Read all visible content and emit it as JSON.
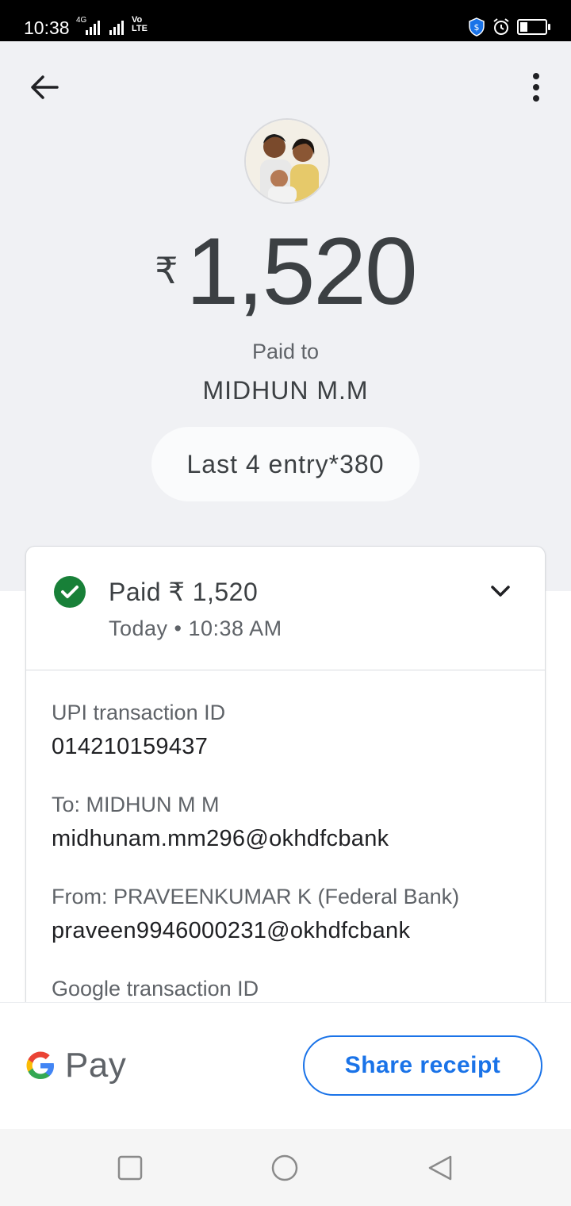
{
  "status_bar": {
    "time": "10:38",
    "network": "4G",
    "volte_top": "Vo",
    "volte_bottom": "LTE",
    "battery_level_percent": 30,
    "icons": [
      "signal-icon",
      "signal-icon",
      "shield-icon",
      "alarm-icon",
      "battery-icon"
    ]
  },
  "header": {
    "back_icon": "arrow-back-icon",
    "menu_icon": "more-vert-icon",
    "avatar": "contact-avatar-photo",
    "currency": "₹",
    "amount": "1,520",
    "paid_to_label": "Paid to",
    "payee_name": "MIDHUN M.M",
    "account_pill": "Last 4 entry*380"
  },
  "transaction_card": {
    "status_title": "Paid ₹ 1,520",
    "status_time": "Today • 10:38 AM",
    "status_icon": "check-circle-icon",
    "expand_icon": "chevron-down-icon",
    "details": [
      {
        "label": "UPI transaction ID",
        "value": "014210159437"
      },
      {
        "label": "To: MIDHUN M M",
        "value": "midhunam.mm296@okhdfcbank"
      },
      {
        "label": "From: PRAVEENKUMAR K (Federal Bank)",
        "value": "praveen9946000231@okhdfcbank"
      },
      {
        "label": "Google transaction ID",
        "value": ""
      }
    ]
  },
  "footer": {
    "logo_text": "Pay",
    "share_label": "Share receipt"
  },
  "colors": {
    "accent": "#1a73e8",
    "success": "#188038",
    "header_bg": "#f0f1f4"
  },
  "nav_bar": [
    "recents-square-icon",
    "home-circle-icon",
    "back-triangle-icon"
  ]
}
